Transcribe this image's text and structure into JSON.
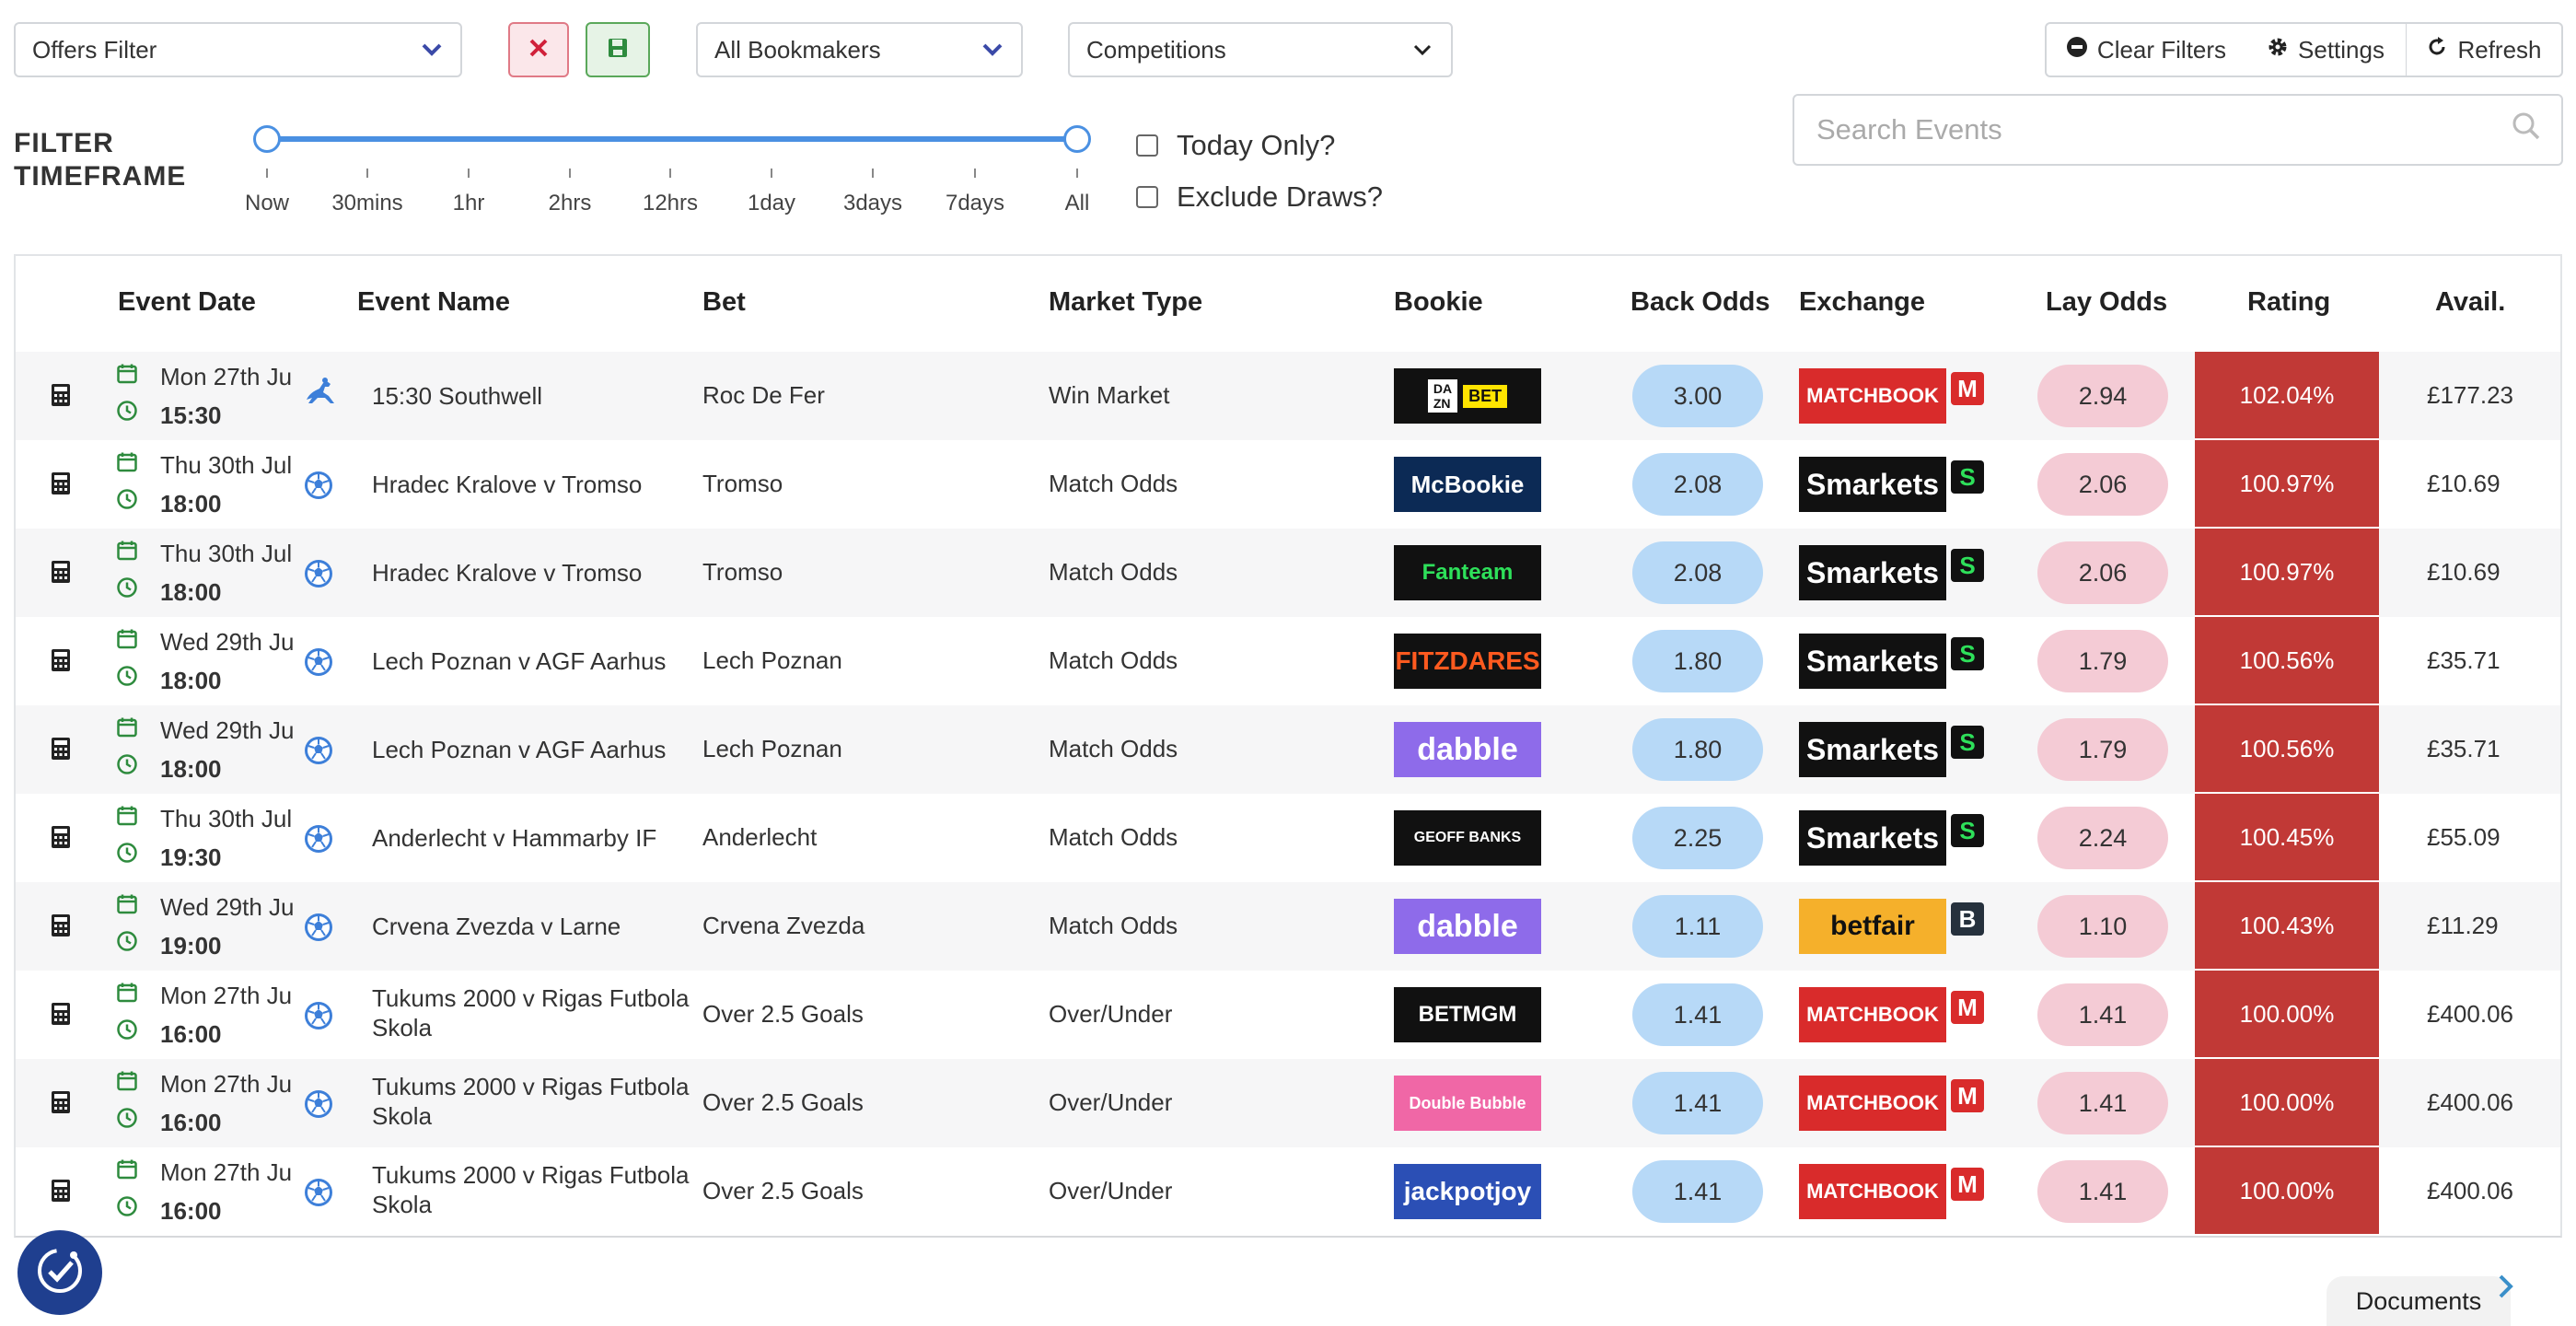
{
  "filters": {
    "offers_filter": "Offers Filter",
    "bookmakers": "All Bookmakers",
    "competitions": "Competitions",
    "clear_filters": "Clear Filters",
    "settings": "Settings",
    "refresh": "Refresh",
    "search_placeholder": "Search Events"
  },
  "timeframe": {
    "title_line1": "FILTER",
    "title_line2": "TIMEFRAME",
    "ticks": [
      "Now",
      "30mins",
      "1hr",
      "2hrs",
      "12hrs",
      "1day",
      "3days",
      "7days",
      "All"
    ],
    "range": [
      "Now",
      "All"
    ]
  },
  "options": {
    "today_only": "Today Only?",
    "exclude_draws": "Exclude Draws?"
  },
  "table": {
    "headers": {
      "event_date": "Event Date",
      "event_name": "Event Name",
      "bet": "Bet",
      "market_type": "Market Type",
      "bookie": "Bookie",
      "back_odds": "Back Odds",
      "exchange": "Exchange",
      "lay_odds": "Lay Odds",
      "rating": "Rating",
      "avail": "Avail."
    },
    "rows": [
      {
        "date": "Mon 27th Ju",
        "time": "15:30",
        "sport": "horse-racing-icon",
        "event": "15:30 Southwell",
        "event2": "",
        "bet": "Roc De Fer",
        "market": "Win Market",
        "bookie": "BET",
        "back": "3.00",
        "exchange": "MATCHBOOK",
        "exicon": "M",
        "lay": "2.94",
        "rating": "102.04%",
        "avail": "£177.23"
      },
      {
        "date": "Thu 30th Jul",
        "time": "18:00",
        "sport": "football-icon",
        "event": "Hradec Kralove v Tromso",
        "event2": "",
        "bet": "Tromso",
        "market": "Match Odds",
        "bookie": "McBookie",
        "back": "2.08",
        "exchange": "Smarkets",
        "exicon": "S",
        "lay": "2.06",
        "rating": "100.97%",
        "avail": "£10.69"
      },
      {
        "date": "Thu 30th Jul",
        "time": "18:00",
        "sport": "football-icon",
        "event": "Hradec Kralove v Tromso",
        "event2": "",
        "bet": "Tromso",
        "market": "Match Odds",
        "bookie": "Fanteam",
        "back": "2.08",
        "exchange": "Smarkets",
        "exicon": "S",
        "lay": "2.06",
        "rating": "100.97%",
        "avail": "£10.69"
      },
      {
        "date": "Wed 29th Ju",
        "time": "18:00",
        "sport": "football-icon",
        "event": "Lech Poznan v AGF Aarhus",
        "event2": "",
        "bet": "Lech Poznan",
        "market": "Match Odds",
        "bookie": "FITZDARES",
        "back": "1.80",
        "exchange": "Smarkets",
        "exicon": "S",
        "lay": "1.79",
        "rating": "100.56%",
        "avail": "£35.71"
      },
      {
        "date": "Wed 29th Ju",
        "time": "18:00",
        "sport": "football-icon",
        "event": "Lech Poznan v AGF Aarhus",
        "event2": "",
        "bet": "Lech Poznan",
        "market": "Match Odds",
        "bookie": "dabble",
        "back": "1.80",
        "exchange": "Smarkets",
        "exicon": "S",
        "lay": "1.79",
        "rating": "100.56%",
        "avail": "£35.71"
      },
      {
        "date": "Thu 30th Jul",
        "time": "19:30",
        "sport": "football-icon",
        "event": "Anderlecht v Hammarby IF",
        "event2": "",
        "bet": "Anderlecht",
        "market": "Match Odds",
        "bookie": "GEOFF BANKS",
        "back": "2.25",
        "exchange": "Smarkets",
        "exicon": "S",
        "lay": "2.24",
        "rating": "100.45%",
        "avail": "£55.09"
      },
      {
        "date": "Wed 29th Ju",
        "time": "19:00",
        "sport": "football-icon",
        "event": "Crvena Zvezda v Larne",
        "event2": "",
        "bet": "Crvena Zvezda",
        "market": "Match Odds",
        "bookie": "dabble",
        "back": "1.11",
        "exchange": "betfair",
        "exicon": "B",
        "lay": "1.10",
        "rating": "100.43%",
        "avail": "£11.29"
      },
      {
        "date": "Mon 27th Ju",
        "time": "16:00",
        "sport": "football-icon",
        "event": "Tukums 2000 v Rigas Futbola",
        "event2": "Skola",
        "bet": "Over 2.5 Goals",
        "market": "Over/Under",
        "bookie": "BETMGM",
        "back": "1.41",
        "exchange": "MATCHBOOK",
        "exicon": "M",
        "lay": "1.41",
        "rating": "100.00%",
        "avail": "£400.06"
      },
      {
        "date": "Mon 27th Ju",
        "time": "16:00",
        "sport": "football-icon",
        "event": "Tukums 2000 v Rigas Futbola",
        "event2": "Skola",
        "bet": "Over 2.5 Goals",
        "market": "Over/Under",
        "bookie": "Double Bubble",
        "back": "1.41",
        "exchange": "MATCHBOOK",
        "exicon": "M",
        "lay": "1.41",
        "rating": "100.00%",
        "avail": "£400.06"
      },
      {
        "date": "Mon 27th Ju",
        "time": "16:00",
        "sport": "football-icon",
        "event": "Tukums 2000 v Rigas Futbola",
        "event2": "Skola",
        "bet": "Over 2.5 Goals",
        "market": "Over/Under",
        "bookie": "jackpotjoy",
        "back": "1.41",
        "exchange": "MATCHBOOK",
        "exicon": "M",
        "lay": "1.41",
        "rating": "100.00%",
        "avail": "£400.06"
      }
    ]
  },
  "footer": {
    "documents": "Documents"
  },
  "colors": {
    "rating_bg": "#c13936",
    "back_pill": "#b7d9f7",
    "lay_pill": "#f4cbd5",
    "icon_green": "#2e8b3e",
    "accent_blue": "#4a90e2"
  }
}
